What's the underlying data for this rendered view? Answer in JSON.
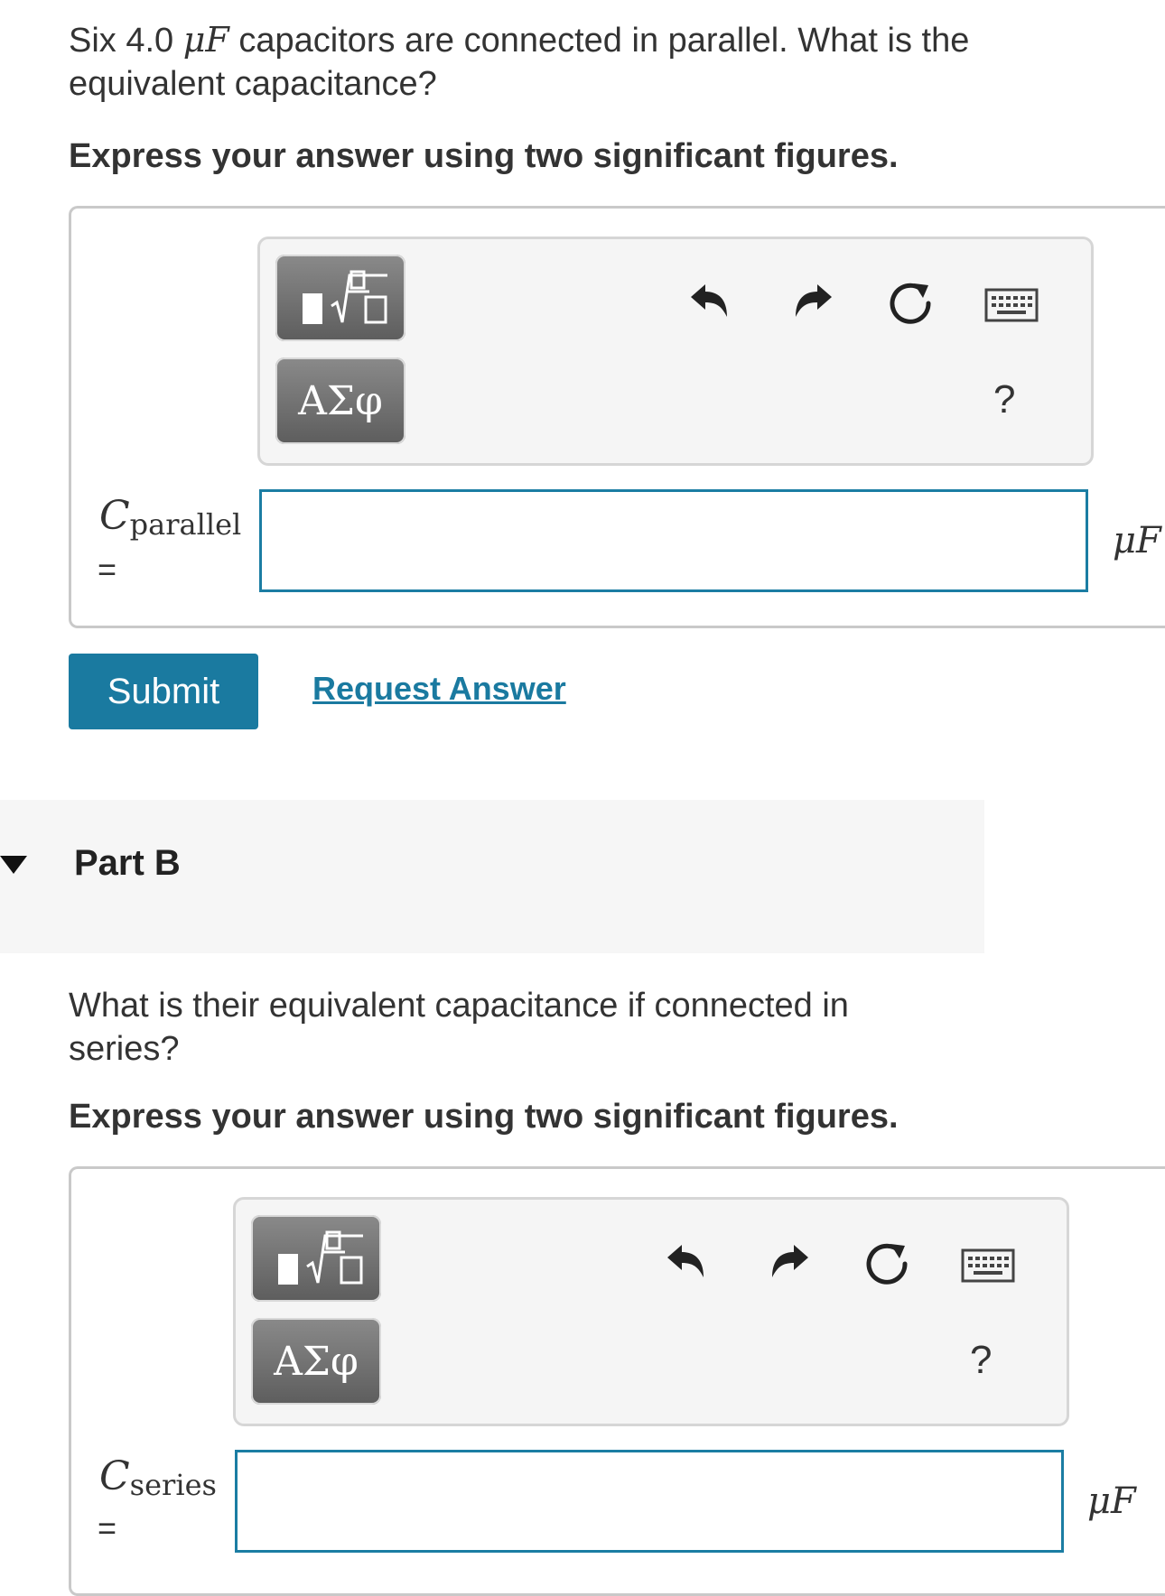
{
  "part_a": {
    "question_before": "Six 4.0 ",
    "question_unit": "μF",
    "question_after": " capacitors are connected in parallel. What is the equivalent capacitance?",
    "instruction": "Express your answer using two significant figures.",
    "variable_symbol": "C",
    "variable_subscript": "parallel",
    "equals": "=",
    "input_value": "",
    "unit": "μF",
    "submit_label": "Submit",
    "request_label": "Request Answer"
  },
  "toolbar": {
    "greek_label": "ΑΣφ",
    "help_label": "?",
    "icons": [
      "templates-icon",
      "greek-letters-button",
      "undo-icon",
      "redo-icon",
      "reset-icon",
      "keyboard-icon",
      "help-icon"
    ]
  },
  "part_b": {
    "title": "Part B",
    "question": "What is their equivalent capacitance if connected in series?",
    "instruction": "Express your answer using two significant figures.",
    "variable_symbol": "C",
    "variable_subscript": "series",
    "equals": "=",
    "input_value": "",
    "unit": "μF"
  },
  "colors": {
    "accent": "#1a7aa0",
    "text": "#333333",
    "toolbar_bg": "#f5f5f5",
    "part_header_bg": "#f6f6f6"
  }
}
